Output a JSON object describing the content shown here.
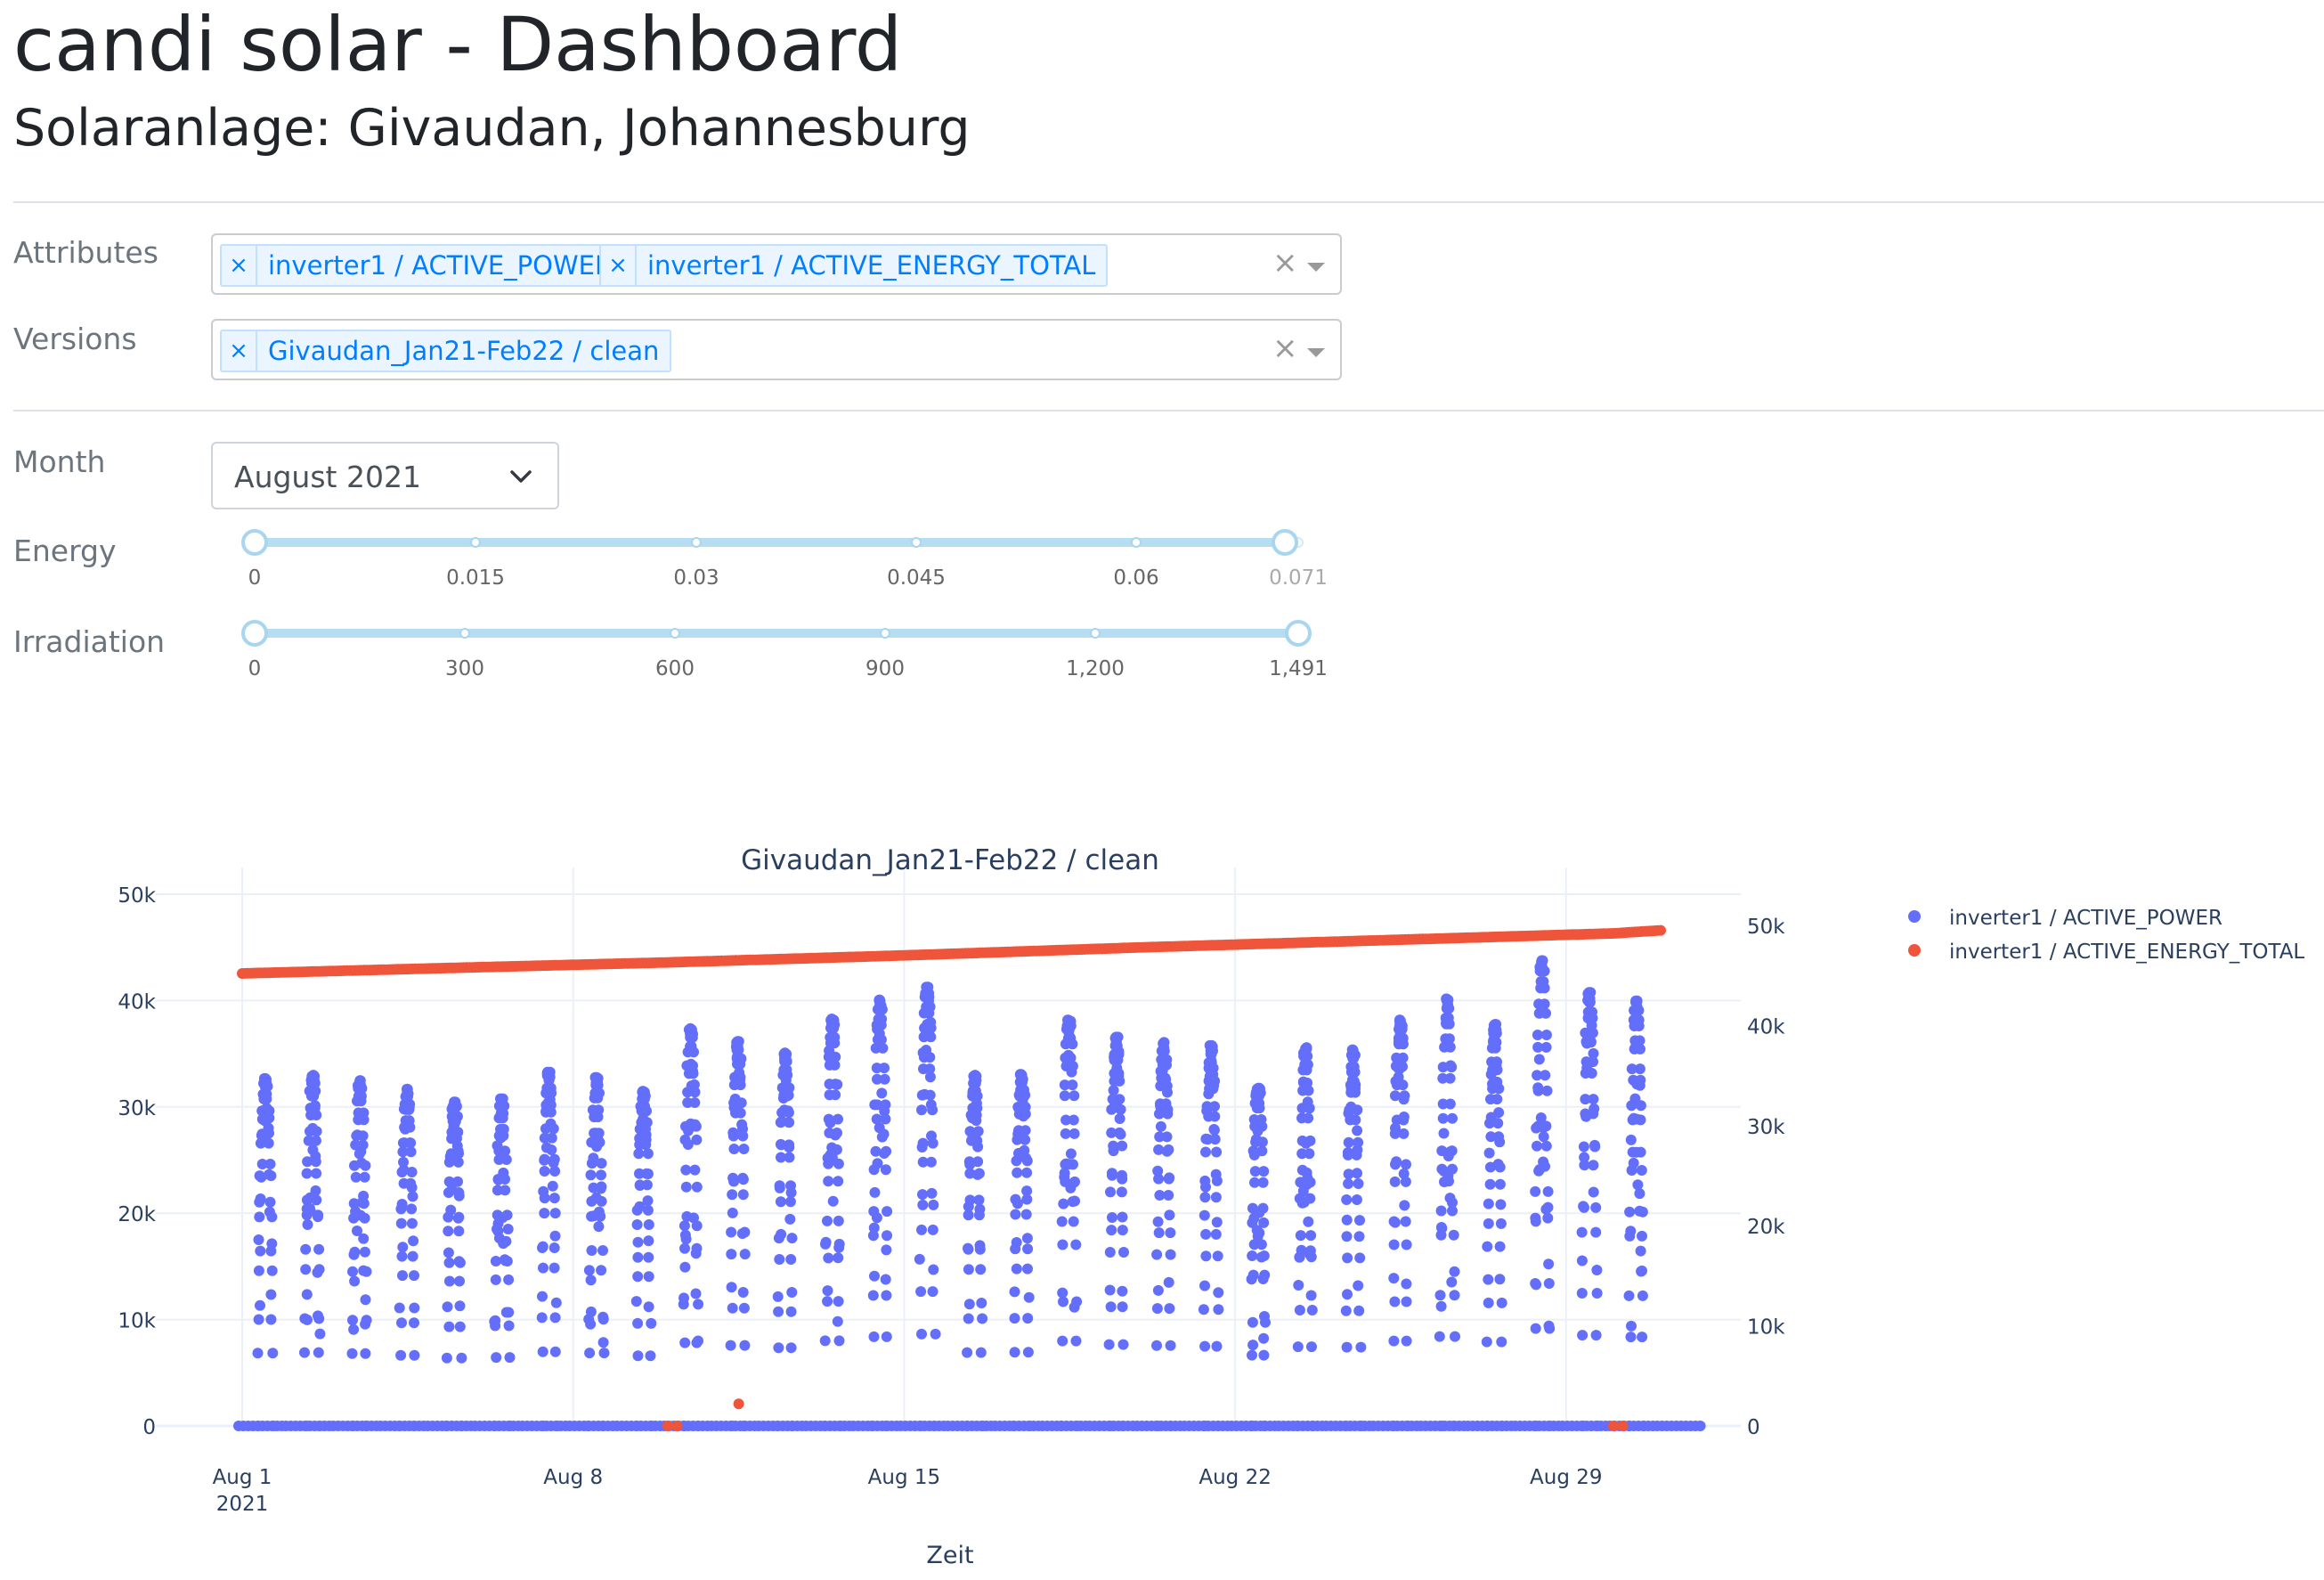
{
  "header": {
    "title": "candi solar - Dashboard",
    "subtitle": "Solaranlage: Givaudan, Johannesburg"
  },
  "filters": {
    "attributes": {
      "label": "Attributes",
      "tags": [
        "inverter1 / ACTIVE_POWER",
        "inverter1 / ACTIVE_ENERGY_TOTAL"
      ]
    },
    "versions": {
      "label": "Versions",
      "tags": [
        "Givaudan_Jan21-Feb22 / clean"
      ]
    },
    "month": {
      "label": "Month",
      "value": "August 2021"
    },
    "energy": {
      "label": "Energy",
      "marks": [
        "0",
        "0.015",
        "0.03",
        "0.045",
        "0.06",
        "0.071"
      ],
      "range": [
        0,
        0.071
      ]
    },
    "irradiation": {
      "label": "Irradiation",
      "marks": [
        "0",
        "300",
        "600",
        "900",
        "1,200",
        "1,491"
      ],
      "range": [
        0,
        1491
      ]
    }
  },
  "colors": {
    "accent": "#007eff",
    "power_series": "#636efa",
    "energy_series": "#ef553b"
  },
  "icons": {
    "tag_remove": "×",
    "clear": "×",
    "dropdown": "caret-down-icon",
    "month_dropdown": "chevron-down-icon"
  },
  "chart_data": {
    "type": "scatter",
    "title": "Givaudan_Jan21-Feb22 / clean",
    "xlabel": "Zeit",
    "ylabel": "",
    "y2label": "",
    "xlim": [
      "2021-08-01",
      "2021-08-31"
    ],
    "ylim": [
      0,
      50000
    ],
    "y2lim": [
      0,
      50000
    ],
    "x_ticks": [
      "Aug 1",
      "Aug 8",
      "Aug 15",
      "Aug 22",
      "Aug 29"
    ],
    "x_tick_year": "2021",
    "y_ticks": [
      "0",
      "10k",
      "20k",
      "30k",
      "40k",
      "50k"
    ],
    "y2_ticks": [
      "0",
      "10k",
      "20k",
      "30k",
      "40k",
      "50k"
    ],
    "grid": true,
    "legend_position": "top-right",
    "series": [
      {
        "name": "inverter1 / ACTIVE_POWER",
        "axis": "y",
        "color": "#636efa",
        "daily_peak": {
          "x": [
            "2021-08-01",
            "2021-08-02",
            "2021-08-03",
            "2021-08-04",
            "2021-08-05",
            "2021-08-06",
            "2021-08-07",
            "2021-08-08",
            "2021-08-09",
            "2021-08-10",
            "2021-08-11",
            "2021-08-12",
            "2021-08-13",
            "2021-08-14",
            "2021-08-15",
            "2021-08-16",
            "2021-08-17",
            "2021-08-18",
            "2021-08-19",
            "2021-08-20",
            "2021-08-21",
            "2021-08-22",
            "2021-08-23",
            "2021-08-24",
            "2021-08-25",
            "2021-08-26",
            "2021-08-27",
            "2021-08-28",
            "2021-08-29",
            "2021-08-30",
            "2021-08-31"
          ],
          "y": [
            32700,
            33000,
            32500,
            31700,
            30500,
            30800,
            33300,
            32800,
            31500,
            37400,
            36200,
            35100,
            38300,
            40100,
            41300,
            33000,
            33100,
            38200,
            36600,
            36100,
            35800,
            31800,
            35600,
            35400,
            38200,
            40200,
            37800,
            43800,
            40800,
            40000,
            0
          ]
        }
      },
      {
        "name": "inverter1 / ACTIVE_ENERGY_TOTAL",
        "axis": "y2",
        "color": "#ef553b",
        "x": [
          "2021-08-01",
          "2021-08-05",
          "2021-08-10",
          "2021-08-15",
          "2021-08-20",
          "2021-08-25",
          "2021-08-30",
          "2021-08-31"
        ],
        "y": [
          45200,
          45700,
          46300,
          47000,
          47800,
          48500,
          49200,
          49500
        ],
        "outliers": {
          "x": [
            "2021-08-10",
            "2021-08-10",
            "2021-08-11",
            "2021-08-30",
            "2021-08-30"
          ],
          "y": [
            0,
            0,
            2200,
            0,
            0
          ]
        }
      }
    ]
  }
}
